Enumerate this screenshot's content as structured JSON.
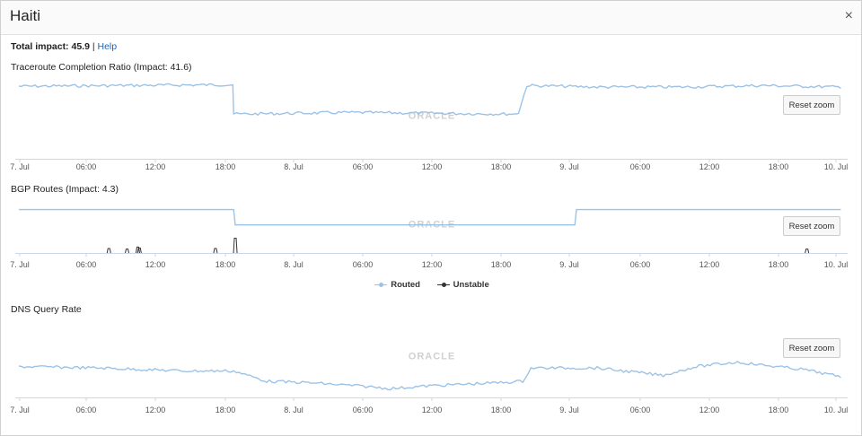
{
  "window": {
    "title": "Haiti",
    "close_glyph": "×"
  },
  "impact": {
    "label": "Total impact: 45.9",
    "separator": "|",
    "help_link": "Help"
  },
  "x_ticks": [
    "7. Jul",
    "06:00",
    "12:00",
    "18:00",
    "8. Jul",
    "06:00",
    "12:00",
    "18:00",
    "9. Jul",
    "06:00",
    "12:00",
    "18:00",
    "10. Jul"
  ],
  "watermark": "ORACLE",
  "reset_label": "Reset zoom",
  "legend": {
    "routed": "Routed",
    "unstable": "Unstable"
  },
  "colors": {
    "series_blue": "#9cc3e6",
    "axis": "#ccd6eb",
    "unstable": "#333333",
    "accent_link": "#1a66b5"
  },
  "icons": {
    "close": "close-icon"
  },
  "charts": [
    {
      "title": "Traceroute Completion Ratio (Impact: 41.6)",
      "series": [
        {
          "key": "ratio",
          "points": [
            [
              0,
              0.94
            ],
            [
              0.25,
              0.96
            ],
            [
              0.259,
              0.96
            ],
            [
              0.26,
              0.58
            ],
            [
              0.27,
              0.58
            ],
            [
              0.4,
              0.6
            ],
            [
              0.5,
              0.59
            ],
            [
              0.6,
              0.58
            ],
            [
              0.605,
              0.6
            ],
            [
              0.615,
              0.95
            ],
            [
              0.7,
              0.93
            ],
            [
              0.8,
              0.93
            ],
            [
              0.9,
              0.95
            ],
            [
              0.995,
              0.93
            ]
          ]
        }
      ]
    },
    {
      "title": "BGP Routes (Impact: 4.3)",
      "series": [
        {
          "key": "routed",
          "points": [
            [
              0,
              0.88
            ],
            [
              0.26,
              0.88
            ],
            [
              0.262,
              0.57
            ],
            [
              0.673,
              0.57
            ],
            [
              0.675,
              0.88
            ],
            [
              0.995,
              0.88
            ]
          ]
        },
        {
          "key": "unstable",
          "spikes": [
            [
              0.109,
              0.09
            ],
            [
              0.131,
              0.08
            ],
            [
              0.144,
              0.12
            ],
            [
              0.146,
              0.1
            ],
            [
              0.238,
              0.09
            ],
            [
              0.262,
              0.3
            ],
            [
              0.954,
              0.08
            ]
          ]
        }
      ]
    },
    {
      "title": "DNS Query Rate",
      "series": [
        {
          "key": "dns",
          "points": [
            [
              0,
              0.42
            ],
            [
              0.1,
              0.4
            ],
            [
              0.2,
              0.36
            ],
            [
              0.26,
              0.36
            ],
            [
              0.3,
              0.22
            ],
            [
              0.35,
              0.2
            ],
            [
              0.42,
              0.15
            ],
            [
              0.45,
              0.12
            ],
            [
              0.5,
              0.16
            ],
            [
              0.58,
              0.2
            ],
            [
              0.61,
              0.22
            ],
            [
              0.62,
              0.4
            ],
            [
              0.7,
              0.4
            ],
            [
              0.78,
              0.3
            ],
            [
              0.82,
              0.42
            ],
            [
              0.87,
              0.48
            ],
            [
              0.9,
              0.44
            ],
            [
              0.95,
              0.38
            ],
            [
              0.995,
              0.28
            ]
          ]
        }
      ]
    }
  ]
}
